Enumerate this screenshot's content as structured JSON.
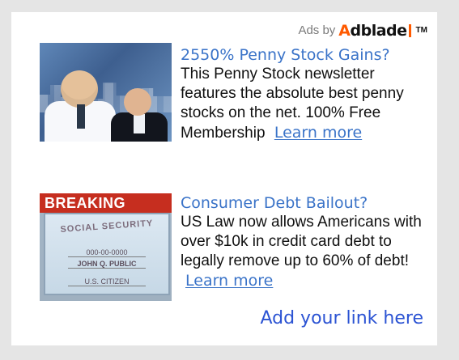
{
  "header": {
    "ads_by_label": "Ads by",
    "brand_name": "Adblade",
    "trademark": "TM"
  },
  "ads": [
    {
      "headline": "2550% Penny Stock Gains?",
      "description": "This Penny Stock newsletter features the absolute best penny stocks on the net. 100% Free Membership",
      "cta": "Learn more"
    },
    {
      "headline": "Consumer Debt Bailout?",
      "description": "US Law now allows Americans with over $10k in credit card debt to legally remove up to 60% of debt!",
      "cta": "Learn more",
      "image_badge": "BREAKING",
      "card_title": "SOCIAL SECURITY",
      "card_number": "000-00-0000",
      "card_name": "JOHN Q. PUBLIC",
      "card_footer": "U.S. CITIZEN"
    }
  ],
  "footer": {
    "add_link": "Add your link here"
  },
  "colors": {
    "page_background": "#e5e5e5",
    "panel_background": "#ffffff",
    "link_blue": "#3a73c8",
    "footer_blue": "#2b53d3",
    "text_dark": "#101010",
    "brand_orange": "#ff5a00"
  }
}
